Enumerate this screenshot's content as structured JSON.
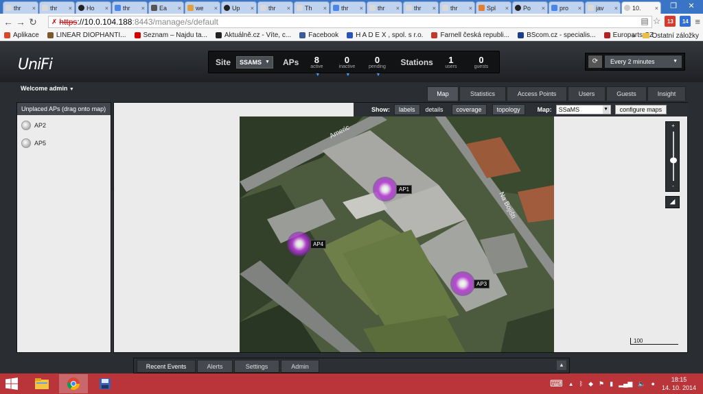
{
  "browser": {
    "tabs": [
      {
        "label": "thr",
        "favicon": "page",
        "favcolor": "#d9d9d9"
      },
      {
        "label": "thr",
        "favicon": "page",
        "favcolor": "#d9d9d9"
      },
      {
        "label": "Ho",
        "favicon": "github",
        "favcolor": "#222222"
      },
      {
        "label": "thr",
        "favicon": "google",
        "favcolor": "#4a86e8"
      },
      {
        "label": "Ea",
        "favicon": "other",
        "favcolor": "#555555"
      },
      {
        "label": "we",
        "favicon": "page",
        "favcolor": "#e0a040"
      },
      {
        "label": "Up",
        "favicon": "github",
        "favcolor": "#222222"
      },
      {
        "label": "thr",
        "favicon": "page",
        "favcolor": "#d9d9d9"
      },
      {
        "label": "Th",
        "favicon": "page",
        "favcolor": "#d9d9d9"
      },
      {
        "label": "thr",
        "favicon": "google",
        "favcolor": "#4a86e8"
      },
      {
        "label": "thr",
        "favicon": "page",
        "favcolor": "#d9d9d9"
      },
      {
        "label": "thr",
        "favicon": "page",
        "favcolor": "#d9d9d9"
      },
      {
        "label": "thr",
        "favicon": "page",
        "favcolor": "#d9d9d9"
      },
      {
        "label": "Spl",
        "favicon": "page",
        "favcolor": "#e08030"
      },
      {
        "label": "Po",
        "favicon": "github",
        "favcolor": "#222222"
      },
      {
        "label": "pro",
        "favicon": "google",
        "favcolor": "#4a86e8"
      },
      {
        "label": "jav",
        "favicon": "page",
        "favcolor": "#d9d9d9"
      },
      {
        "label": "10.",
        "favicon": "unifi",
        "favcolor": "#cccccc",
        "active": true
      }
    ],
    "url": {
      "scheme": "https",
      "host": "://10.0.104.188",
      "path": ":8443/manage/s/default"
    },
    "extensions": [
      {
        "label": "13",
        "color": "#d63a2f"
      },
      {
        "label": "14",
        "color": "#2f6fd6"
      }
    ],
    "bookmarks": [
      {
        "label": "Aplikace",
        "color": "#d9472b"
      },
      {
        "label": "LINEAR DIOPHANTI...",
        "color": "#7a5a2a"
      },
      {
        "label": "Seznam – Najdu ta...",
        "color": "#d40000"
      },
      {
        "label": "Aktuálně.cz - Víte, c...",
        "color": "#222222"
      },
      {
        "label": "Facebook",
        "color": "#3b5998"
      },
      {
        "label": "H A D E X , spol. s r.o.",
        "color": "#2a52be"
      },
      {
        "label": "Farnell česká republi...",
        "color": "#c0392b"
      },
      {
        "label": "BScom.cz - specialis...",
        "color": "#1a3d8c"
      },
      {
        "label": "Europarts CZ",
        "color": "#b22222"
      }
    ],
    "bookmarks_more": "»",
    "other_bookmarks": "Ostatní záložky"
  },
  "header": {
    "logo_text": "UniFi",
    "site_label": "Site",
    "site_value": "SSAMS",
    "aps_label": "APs",
    "stats": [
      {
        "num": "8",
        "sub": "active"
      },
      {
        "num": "0",
        "sub": "inactive"
      },
      {
        "num": "0",
        "sub": "pending"
      }
    ],
    "stations_label": "Stations",
    "station_stats": [
      {
        "num": "1",
        "sub": "users"
      },
      {
        "num": "0",
        "sub": "guests"
      }
    ],
    "refresh_label": "Every 2 minutes"
  },
  "welcome": "Welcome admin",
  "nav_tabs": [
    "Map",
    "Statistics",
    "Access Points",
    "Users",
    "Guests",
    "Insight"
  ],
  "unplaced": {
    "title": "Unplaced APs (drag onto map)",
    "items": [
      "AP2",
      "AP5"
    ]
  },
  "map_toolbar": {
    "show_label": "Show:",
    "labels": "labels",
    "details": "details",
    "coverage": "coverage",
    "topology": "topology",
    "map_label": "Map:",
    "map_value": "SSaMS",
    "configure": "configure maps"
  },
  "map": {
    "street_1": "Americ",
    "street_2": "Na Bojišti",
    "scale": "100",
    "aps": [
      "AP1",
      "AP4",
      "AP3"
    ]
  },
  "bottom_tabs": [
    "Recent Events",
    "Alerts",
    "Settings",
    "Admin"
  ],
  "taskbar": {
    "time": "18:15",
    "date": "14. 10. 2014"
  }
}
